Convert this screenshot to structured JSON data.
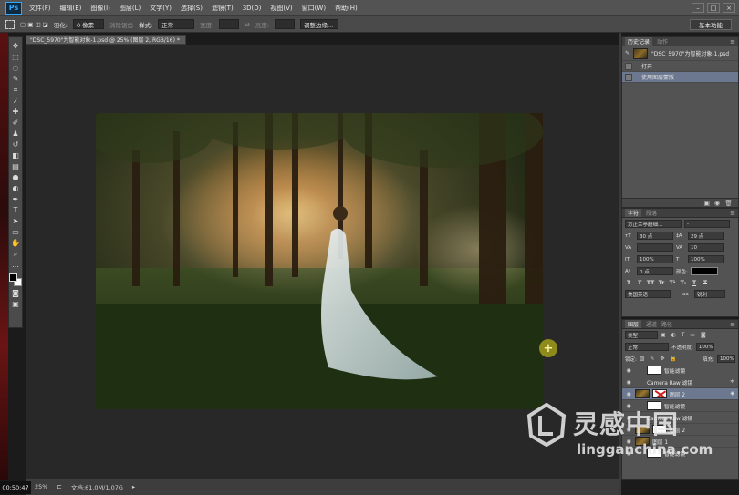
{
  "menubar": {
    "logo": "Ps",
    "items": [
      "文件(F)",
      "编辑(E)",
      "图像(I)",
      "图层(L)",
      "文字(Y)",
      "选择(S)",
      "滤镜(T)",
      "3D(D)",
      "视图(V)",
      "窗口(W)",
      "帮助(H)"
    ],
    "controls": [
      "–",
      "□",
      "×"
    ]
  },
  "options": {
    "feather_label": "羽化:",
    "feather_value": "0 像素",
    "antialias": "消除锯齿",
    "style_label": "样式:",
    "style_value": "正常",
    "width_label": "宽度:",
    "height_label": "高度:",
    "refine_edge": "调整边缘...",
    "workspace": "基本功能"
  },
  "document": {
    "tab_title": "\"DSC_5970\"为智能对象-1.psd @ 25% (图层 2, RGB/16) *",
    "close": "×"
  },
  "statusbar": {
    "zoom": "25%",
    "doc_info": "文档:61.0M/1.07G",
    "clock": "00:50:47"
  },
  "history_panel": {
    "tabs": [
      "历史记录",
      "动作"
    ],
    "snapshot": "\"DSC_5970\"为智能对象-1.psd",
    "rows": [
      {
        "label": "打开"
      },
      {
        "label": "使用图层蒙版"
      }
    ]
  },
  "character_panel": {
    "tabs": [
      "字符",
      "段落"
    ],
    "font_family": "方正兰亭超细...",
    "font_style": "-",
    "size": "30 点",
    "leading": "29 点",
    "kerning": "",
    "tracking": "10",
    "v_scale": "100%",
    "h_scale": "100%",
    "baseline": "0 点",
    "color_label": "颜色:",
    "language": "美国英语",
    "aa": "锐利",
    "style_buttons": [
      "T",
      "T",
      "TT",
      "Tr",
      "T¹",
      "T₁",
      "T",
      "T"
    ]
  },
  "layers_panel": {
    "tabs": [
      "图层",
      "通道",
      "路径"
    ],
    "kind": "类型",
    "blend_mode": "正常",
    "opacity_label": "不透明度:",
    "opacity": "100%",
    "lock_label": "锁定:",
    "fill_label": "填充:",
    "fill": "100%",
    "rows": [
      {
        "name": "智能滤镜",
        "thumb": "white",
        "indent": true
      },
      {
        "name": "Camera Raw 滤镜",
        "thumb": "none",
        "indent": true
      },
      {
        "name": "图层 2",
        "thumb": "photo-t",
        "mask": true,
        "selected": true
      },
      {
        "name": "智能滤镜",
        "thumb": "white",
        "indent": true
      },
      {
        "name": "Camera Raw 滤镜",
        "thumb": "none",
        "indent": true
      },
      {
        "name": "图层 2",
        "thumb": "photo-t",
        "mask": true
      },
      {
        "name": "图层 1",
        "thumb": "photo-t"
      },
      {
        "name": "智能滤镜",
        "thumb": "white",
        "indent": true
      }
    ]
  },
  "watermark": {
    "title": "灵感中国",
    "url": "lingganchina.com"
  },
  "colors": {
    "accent": "#31a8ff",
    "selection": "#6b7890",
    "cursor": "#8f8a1c"
  }
}
